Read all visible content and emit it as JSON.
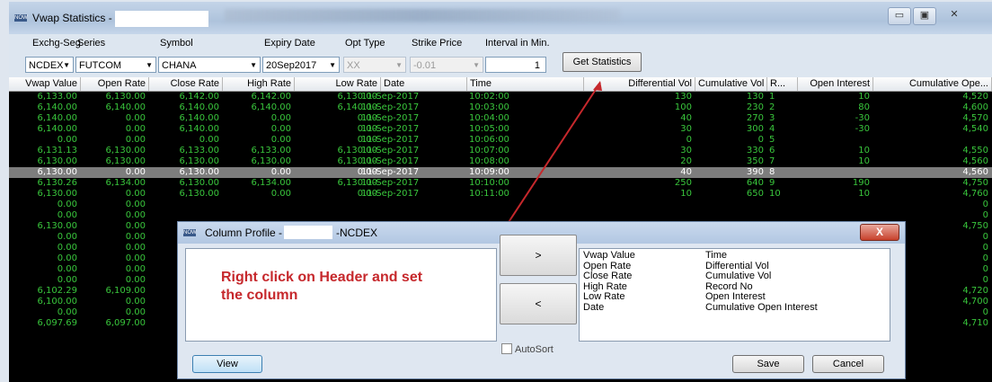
{
  "window": {
    "title": "Vwap Statistics -",
    "app_icon": "NOW",
    "min_icon": "▭",
    "max_icon": "▣",
    "close_icon": "✕"
  },
  "controls": {
    "exchg_seg": {
      "label": "Exchg-Seg",
      "value": "NCDEX"
    },
    "series": {
      "label": "Series",
      "value": "FUTCOM"
    },
    "symbol": {
      "label": "Symbol",
      "value": "CHANA"
    },
    "expiry": {
      "label": "Expiry Date",
      "value": "20Sep2017"
    },
    "opt_type": {
      "label": "Opt Type",
      "value": "XX"
    },
    "strike": {
      "label": "Strike Price",
      "value": "-0.01"
    },
    "interval": {
      "label": "Interval in Min.",
      "value": "1"
    },
    "get_stats": "Get Statistics"
  },
  "grid": {
    "columns": [
      "Vwap Value",
      "Open Rate",
      "Close Rate",
      "High Rate",
      "Low Rate",
      "Date",
      "Time",
      "Differential Vol",
      "Cumulative Vol",
      "R...",
      "Open Interest",
      "Cumulative Ope..."
    ],
    "rows": [
      [
        "6,133.00",
        "6,130.00",
        "6,142.00",
        "6,142.00",
        "6,130.00",
        "11-Sep-2017",
        "10:02:00",
        "130",
        "130",
        "1",
        "10",
        "4,520"
      ],
      [
        "6,140.00",
        "6,140.00",
        "6,140.00",
        "6,140.00",
        "6,140.00",
        "11-Sep-2017",
        "10:03:00",
        "100",
        "230",
        "2",
        "80",
        "4,600"
      ],
      [
        "6,140.00",
        "0.00",
        "6,140.00",
        "0.00",
        "0.00",
        "11-Sep-2017",
        "10:04:00",
        "40",
        "270",
        "3",
        "-30",
        "4,570"
      ],
      [
        "6,140.00",
        "0.00",
        "6,140.00",
        "0.00",
        "0.00",
        "11-Sep-2017",
        "10:05:00",
        "30",
        "300",
        "4",
        "-30",
        "4,540"
      ],
      [
        "0.00",
        "0.00",
        "0.00",
        "0.00",
        "0.00",
        "11-Sep-2017",
        "10:06:00",
        "0",
        "0",
        "5",
        "",
        ""
      ],
      [
        "6,131.13",
        "6,130.00",
        "6,133.00",
        "6,133.00",
        "6,130.00",
        "11-Sep-2017",
        "10:07:00",
        "30",
        "330",
        "6",
        "10",
        "4,550"
      ],
      [
        "6,130.00",
        "6,130.00",
        "6,130.00",
        "6,130.00",
        "6,130.00",
        "11-Sep-2017",
        "10:08:00",
        "20",
        "350",
        "7",
        "10",
        "4,560"
      ],
      [
        "6,130.00",
        "0.00",
        "6,130.00",
        "0.00",
        "0.00",
        "11-Sep-2017",
        "10:09:00",
        "40",
        "390",
        "8",
        "",
        "4,560"
      ],
      [
        "6,130.26",
        "6,134.00",
        "6,130.00",
        "6,134.00",
        "6,130.00",
        "11-Sep-2017",
        "10:10:00",
        "250",
        "640",
        "9",
        "190",
        "4,750"
      ],
      [
        "6,130.00",
        "0.00",
        "6,130.00",
        "0.00",
        "0.00",
        "11-Sep-2017",
        "10:11:00",
        "10",
        "650",
        "10",
        "10",
        "4,760"
      ],
      [
        "0.00",
        "0.00",
        "",
        "",
        "",
        "",
        "",
        "",
        "",
        "",
        "",
        "0"
      ],
      [
        "0.00",
        "0.00",
        "",
        "",
        "",
        "",
        "",
        "",
        "",
        "",
        "",
        "0"
      ],
      [
        "6,130.00",
        "0.00",
        "",
        "",
        "",
        "",
        "",
        "",
        "",
        "",
        "",
        "4,750"
      ],
      [
        "0.00",
        "0.00",
        "",
        "",
        "",
        "",
        "",
        "",
        "",
        "",
        "",
        "0"
      ],
      [
        "0.00",
        "0.00",
        "",
        "",
        "",
        "",
        "",
        "",
        "",
        "",
        "",
        "0"
      ],
      [
        "0.00",
        "0.00",
        "",
        "",
        "",
        "",
        "",
        "",
        "",
        "",
        "",
        "0"
      ],
      [
        "0.00",
        "0.00",
        "",
        "",
        "",
        "",
        "",
        "",
        "",
        "",
        "",
        "0"
      ],
      [
        "0.00",
        "0.00",
        "",
        "",
        "",
        "",
        "",
        "",
        "",
        "",
        "",
        "0"
      ],
      [
        "6,102.29",
        "6,109.00",
        "",
        "",
        "",
        "",
        "",
        "",
        "",
        "",
        "",
        "4,720"
      ],
      [
        "6,100.00",
        "0.00",
        "",
        "",
        "",
        "",
        "",
        "",
        "",
        "",
        "",
        "4,700"
      ],
      [
        "0.00",
        "0.00",
        "",
        "",
        "",
        "",
        "",
        "",
        "",
        "",
        "",
        "0"
      ],
      [
        "6,097.69",
        "6,097.00",
        "",
        "",
        "",
        "",
        "",
        "",
        "",
        "",
        "",
        "4,710"
      ]
    ]
  },
  "dialog": {
    "title_left": "Column Profile -",
    "title_right": "-NCDEX",
    "hint_line1": "Right click on Header and set",
    "hint_line2": "the column",
    "move_right": ">",
    "move_left": "<",
    "fields_left": [
      "Vwap Value",
      "Open Rate",
      "Close Rate",
      "High Rate",
      "Low Rate",
      "Date"
    ],
    "fields_right": [
      "Time",
      "Differential Vol",
      "Cumulative Vol",
      "Record No",
      "Open Interest",
      "Cumulative Open Interest"
    ],
    "autosort": "AutoSort",
    "view": "View",
    "save": "Save",
    "cancel": "Cancel",
    "close_icon": "X"
  },
  "colors": {
    "grid_text": "#39c63c",
    "selected_row": "#7d7d7d",
    "hint": "#c6282c"
  }
}
